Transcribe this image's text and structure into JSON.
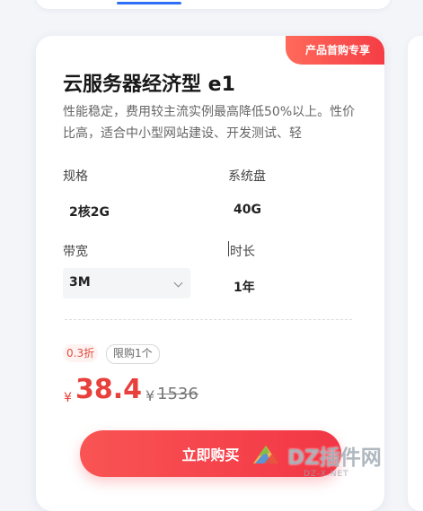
{
  "card": {
    "promo_tag": "产品首购专享",
    "title": "云服务器经济型 e1",
    "description": "性能稳定，费用较主流实例最高降低50%以上。性价比高，适合中小型网站建设、开发测试、轻",
    "spec_label": "规格",
    "spec_value": "2核2G",
    "disk_label": "系统盘",
    "disk_value": "40G",
    "bandwidth_label": "带宽",
    "bandwidth_value": "3M",
    "duration_label": "时长",
    "duration_value": "1年",
    "discount_badge": "0.3折",
    "limit_badge": "限购1个",
    "currency_symbol": "¥",
    "price": "38.4",
    "original_price": "1536",
    "buy_label": "立即购买"
  },
  "watermark": {
    "text": "DZ插件网",
    "sub": "DZ-X.NET"
  },
  "colors": {
    "accent_red": "#e8403b",
    "button_red": "#f23645",
    "tab_blue": "#2f6ff6"
  }
}
